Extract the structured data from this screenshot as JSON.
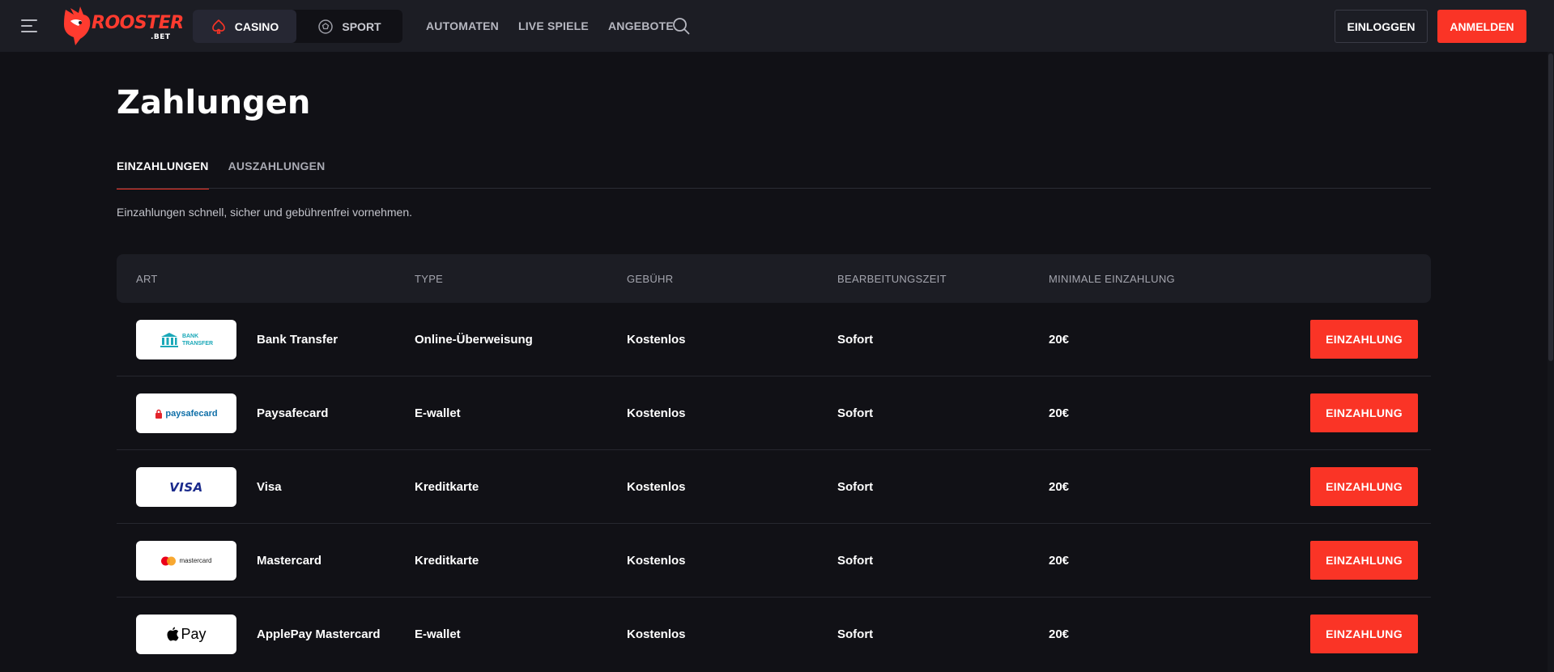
{
  "header": {
    "logo_text": "ROOSTER",
    "logo_sub": ".BET",
    "switch": {
      "casino": "CASINO",
      "sport": "SPORT"
    },
    "nav": [
      "AUTOMATEN",
      "LIVE SPIELE",
      "ANGEBOTE"
    ],
    "login_label": "EINLOGGEN",
    "register_label": "ANMELDEN"
  },
  "colors": {
    "accent": "#fa3426",
    "background": "#111116",
    "header": "#1c1d24"
  },
  "page": {
    "title": "Zahlungen",
    "tabs": [
      "EINZAHLUNGEN",
      "AUSZAHLUNGEN"
    ],
    "active_tab": "EINZAHLUNGEN",
    "subtitle": "Einzahlungen schnell, sicher und gebührenfrei vornehmen."
  },
  "table": {
    "columns": [
      "ART",
      "TYPE",
      "GEBÜHR",
      "BEARBEITUNGSZEIT",
      "MINIMALE EINZAHLUNG"
    ],
    "rows": [
      {
        "logo": "bank-transfer",
        "logo_text": [
          "BANK",
          "TRANSFER"
        ],
        "name": "Bank Transfer",
        "type": "Online-Überweisung",
        "fee": "Kostenlos",
        "time": "Sofort",
        "min": "20€",
        "action": "EINZAHLUNG"
      },
      {
        "logo": "paysafecard",
        "logo_text": [
          "paysafecard"
        ],
        "name": "Paysafecard",
        "type": "E-wallet",
        "fee": "Kostenlos",
        "time": "Sofort",
        "min": "20€",
        "action": "EINZAHLUNG"
      },
      {
        "logo": "visa",
        "logo_text": [
          "VISA"
        ],
        "name": "Visa",
        "type": "Kreditkarte",
        "fee": "Kostenlos",
        "time": "Sofort",
        "min": "20€",
        "action": "EINZAHLUNG"
      },
      {
        "logo": "mastercard",
        "logo_text": [
          "mastercard"
        ],
        "name": "Mastercard",
        "type": "Kreditkarte",
        "fee": "Kostenlos",
        "time": "Sofort",
        "min": "20€",
        "action": "EINZAHLUNG"
      },
      {
        "logo": "apple-pay",
        "logo_text": [
          "Pay"
        ],
        "name": "ApplePay Mastercard",
        "type": "E-wallet",
        "fee": "Kostenlos",
        "time": "Sofort",
        "min": "20€",
        "action": "EINZAHLUNG"
      }
    ]
  }
}
